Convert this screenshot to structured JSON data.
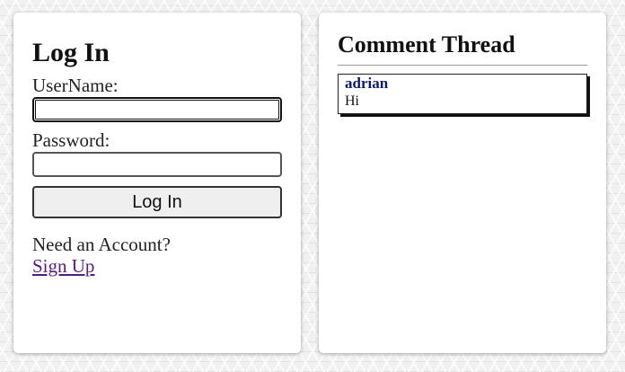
{
  "login": {
    "title": "Log In",
    "username_label": "UserName:",
    "username_value": "",
    "password_label": "Password:",
    "password_value": "",
    "submit_label": "Log In",
    "need_account_text": "Need an Account?",
    "signup_link": "Sign Up"
  },
  "thread": {
    "title": "Comment Thread",
    "comments": [
      {
        "author": "adrian",
        "text": "Hi"
      }
    ]
  }
}
